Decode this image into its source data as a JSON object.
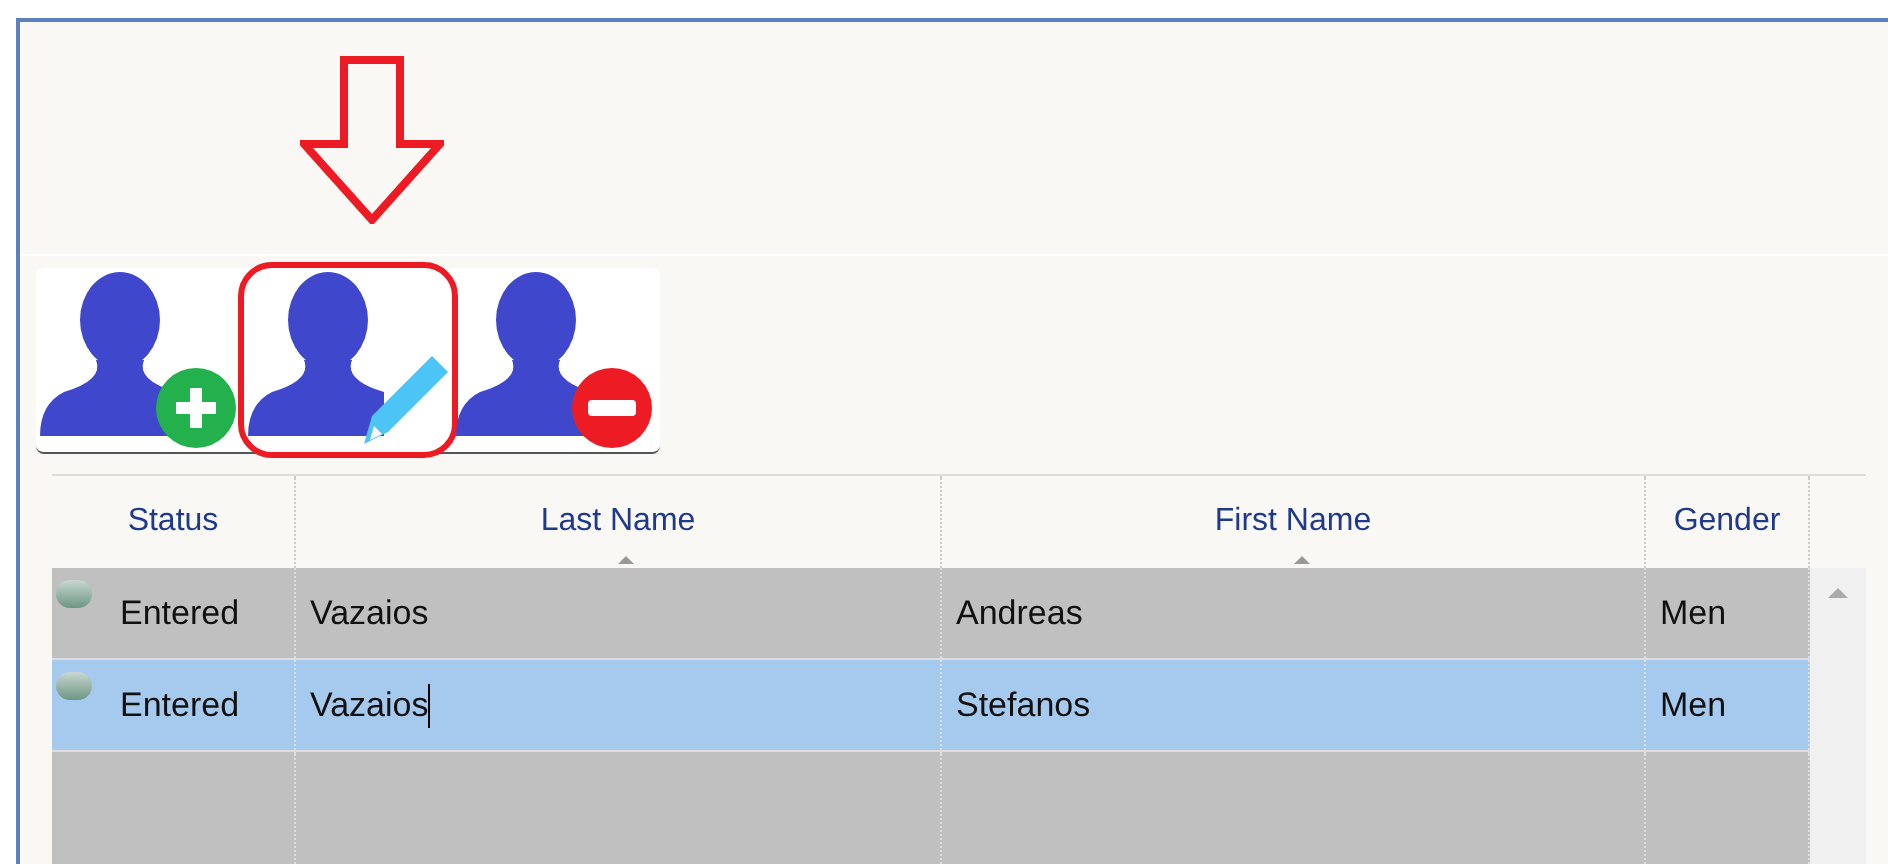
{
  "toolbar": {
    "buttons": [
      {
        "kind": "add",
        "highlighted": false
      },
      {
        "kind": "edit",
        "highlighted": true
      },
      {
        "kind": "remove",
        "highlighted": false
      }
    ]
  },
  "table": {
    "columns": [
      {
        "label": "Status",
        "sorted": false
      },
      {
        "label": "Last Name",
        "sorted": true
      },
      {
        "label": "First Name",
        "sorted": true
      },
      {
        "label": "Gender",
        "sorted": false
      }
    ],
    "rows": [
      {
        "status": "Entered",
        "last_name": "Vazaios",
        "first_name": "Andreas",
        "gender": "Men",
        "selected": false,
        "editing": false
      },
      {
        "status": "Entered",
        "last_name": "Vazaios",
        "first_name": "Stefanos",
        "gender": "Men",
        "selected": true,
        "editing": true
      }
    ]
  }
}
